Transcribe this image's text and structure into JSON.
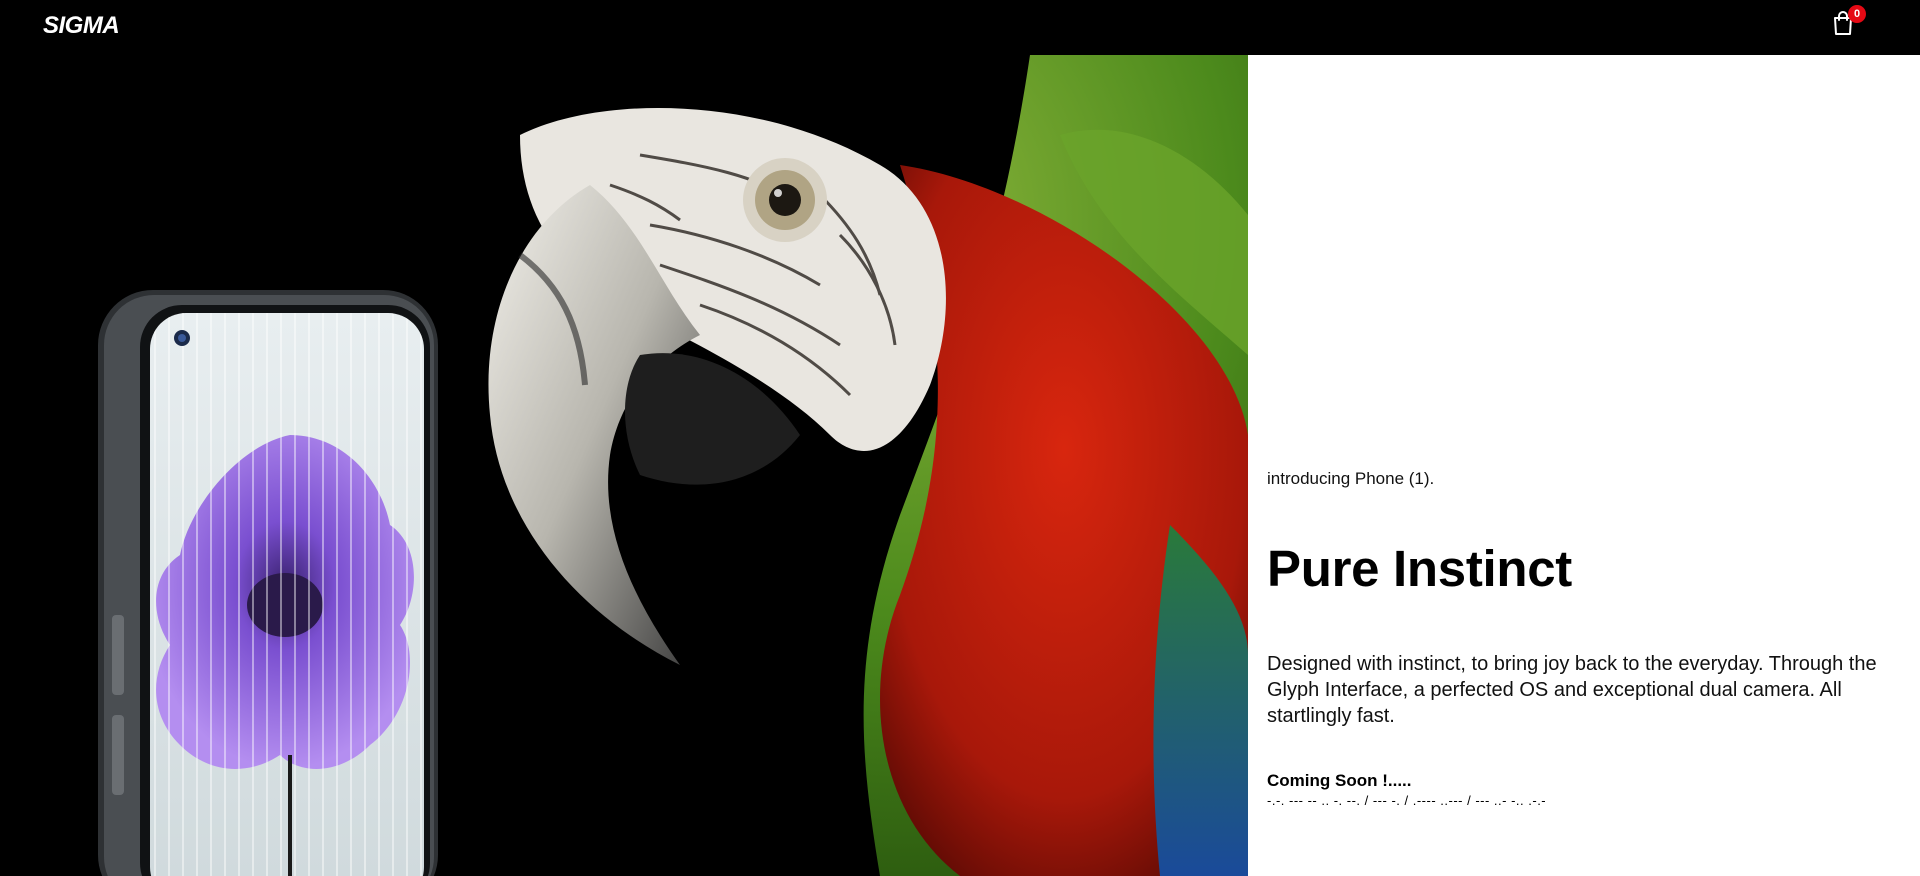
{
  "navbar": {
    "brand": "SIGMA",
    "cart_count": "0",
    "cart_icon": "shopping-bag-icon"
  },
  "hero": {
    "image": "phone-and-macaw-hero-image",
    "colors": {
      "background": "#000000",
      "macaw_red": "#c0200c",
      "macaw_green": "#5a9a1a",
      "flower_purple": "#7a4fd0"
    }
  },
  "info": {
    "intro": "introducing Phone (1).",
    "headline": "Pure Instinct",
    "description": "Designed with instinct, to bring joy back to the everyday. Through the Glyph Interface, a perfected OS and exceptional dual camera. All startlingly fast.",
    "coming_soon": "Coming Soon !.....",
    "morse": "-.-. --- -- .. -. --. / --- -. / .---- ..--- / --- ..- -.. .-.-"
  },
  "colors": {
    "accent_badge": "#e50914",
    "nav_bg": "#000000",
    "panel_bg": "#ffffff"
  }
}
